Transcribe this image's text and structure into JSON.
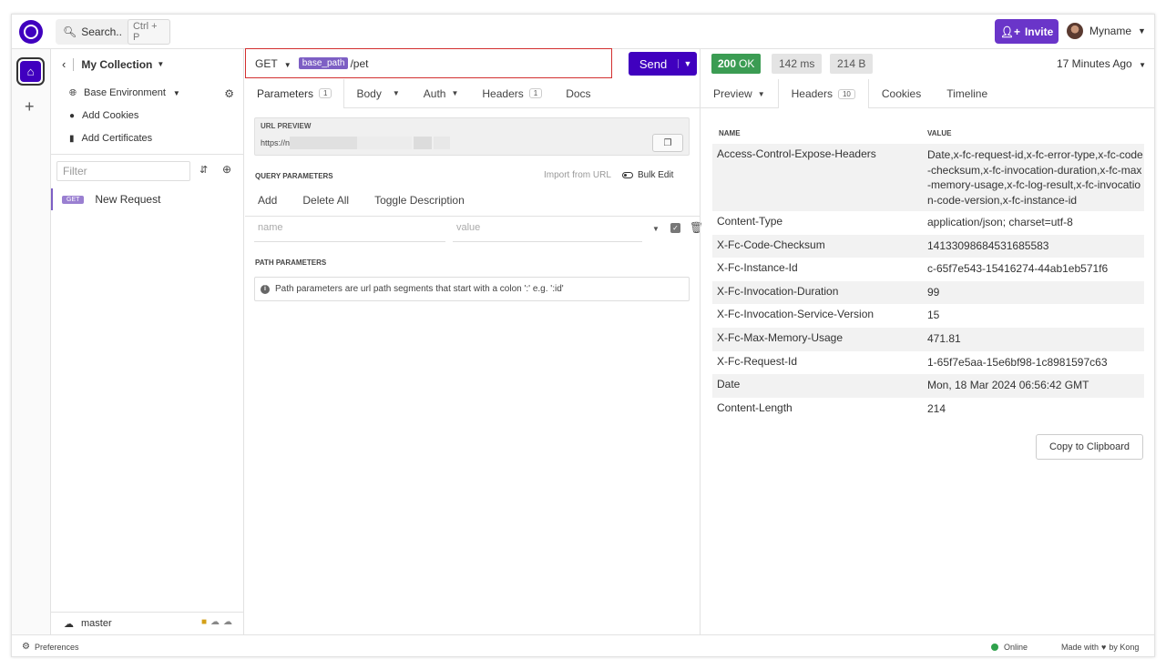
{
  "topbar": {
    "search_label": "Search..",
    "search_shortcut": "Ctrl + P",
    "invite_label": "Invite",
    "user_name": "Myname"
  },
  "sidebar": {
    "collection_name": "My Collection",
    "links": [
      {
        "label": "Base Environment",
        "icon": "globe-icon"
      },
      {
        "label": "Add Cookies",
        "icon": "cookie-icon"
      },
      {
        "label": "Add Certificates",
        "icon": "certificate-icon"
      }
    ],
    "filter_placeholder": "Filter",
    "requests": [
      {
        "method": "GET",
        "name": "New Request"
      }
    ],
    "branch": "master"
  },
  "request": {
    "method": "GET",
    "base_tag": "base_path",
    "path": "/pet",
    "send_label": "Send",
    "tabs": [
      {
        "label": "Parameters",
        "count": "1"
      },
      {
        "label": "Body",
        "count": ""
      },
      {
        "label": "Auth",
        "count": ""
      },
      {
        "label": "Headers",
        "count": "1"
      },
      {
        "label": "Docs",
        "count": ""
      }
    ],
    "url_preview_title": "URL PREVIEW",
    "url_preview_value": "https://n",
    "query_title": "QUERY PARAMETERS",
    "import_label": "Import from URL",
    "bulk_label": "Bulk Edit",
    "qp_actions": [
      "Add",
      "Delete All",
      "Toggle Description"
    ],
    "name_placeholder": "name",
    "value_placeholder": "value",
    "path_title": "PATH PARAMETERS",
    "path_info": "Path parameters are url path segments that start with a colon ':' e.g. ':id'"
  },
  "response": {
    "status_code": "200",
    "status_text": "OK",
    "time": "142 ms",
    "size": "214 B",
    "ago": "17 Minutes Ago",
    "tabs": [
      {
        "label": "Preview",
        "count": ""
      },
      {
        "label": "Headers",
        "count": "10"
      },
      {
        "label": "Cookies",
        "count": ""
      },
      {
        "label": "Timeline",
        "count": ""
      }
    ],
    "col_name": "NAME",
    "col_value": "VALUE",
    "headers": [
      {
        "name": "Access-Control-Expose-Headers",
        "value": "Date,x-fc-request-id,x-fc-error-type,x-fc-code-checksum,x-fc-invocation-duration,x-fc-max-memory-usage,x-fc-log-result,x-fc-invocation-code-version,x-fc-instance-id"
      },
      {
        "name": "Content-Type",
        "value": "application/json; charset=utf-8"
      },
      {
        "name": "X-Fc-Code-Checksum",
        "value": "14133098684531685583"
      },
      {
        "name": "X-Fc-Instance-Id",
        "value": "c-65f7e543-15416274-44ab1eb571f6"
      },
      {
        "name": "X-Fc-Invocation-Duration",
        "value": "99"
      },
      {
        "name": "X-Fc-Invocation-Service-Version",
        "value": "15"
      },
      {
        "name": "X-Fc-Max-Memory-Usage",
        "value": "471.81"
      },
      {
        "name": "X-Fc-Request-Id",
        "value": "1-65f7e5aa-15e6bf98-1c8981597c63"
      },
      {
        "name": "Date",
        "value": "Mon, 18 Mar 2024 06:56:42 GMT"
      },
      {
        "name": "Content-Length",
        "value": "214"
      }
    ],
    "copy_label": "Copy to Clipboard"
  },
  "statusbar": {
    "preferences": "Preferences",
    "online": "Online",
    "made_with": "Made with",
    "by": "by Kong"
  },
  "colors": {
    "accent": "#4000bf",
    "status_ok": "#3b9c53",
    "highlight_border": "#d32f2f"
  }
}
